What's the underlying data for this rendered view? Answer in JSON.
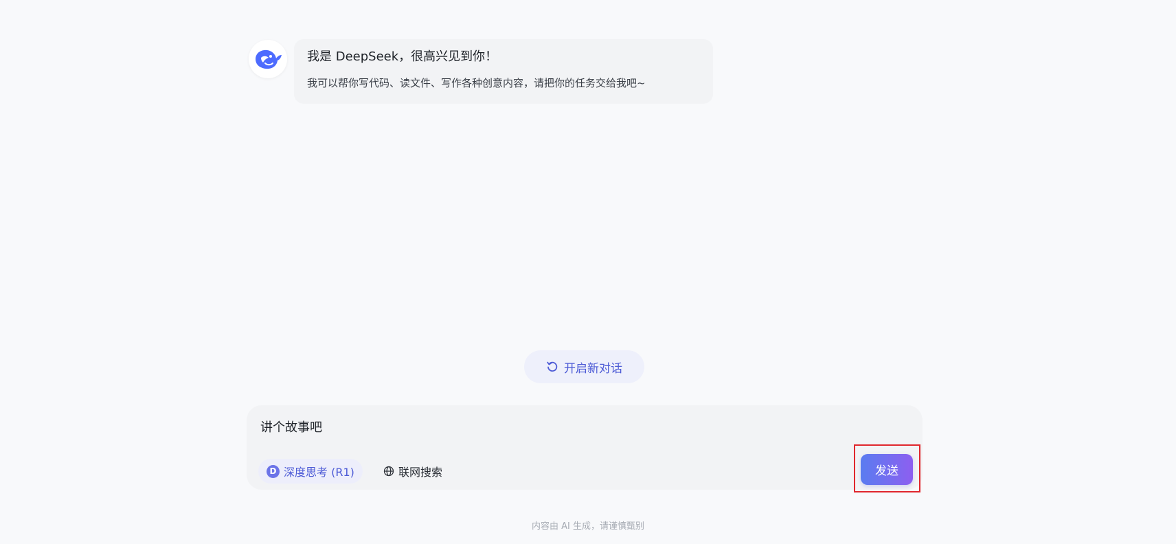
{
  "welcome": {
    "greeting": "我是 DeepSeek，很高兴见到你！",
    "subtitle": "我可以帮你写代码、读文件、写作各种创意内容，请把你的任务交给我吧~"
  },
  "new_chat": {
    "label": "开启新对话",
    "icon": "refresh-icon"
  },
  "composer": {
    "input_value": "讲个故事吧",
    "deep_think": {
      "badge": "D",
      "label": "深度思考 (R1)"
    },
    "web_search": {
      "label": "联网搜索",
      "icon": "globe-icon"
    },
    "send_label": "发送"
  },
  "footer": {
    "disclaimer": "内容由 AI 生成，请谨慎甄别"
  },
  "colors": {
    "accent": "#4d5bd6",
    "send_gradient_start": "#5a7cf0",
    "send_gradient_end": "#8d5ff0",
    "highlight_border": "#e0262c"
  }
}
